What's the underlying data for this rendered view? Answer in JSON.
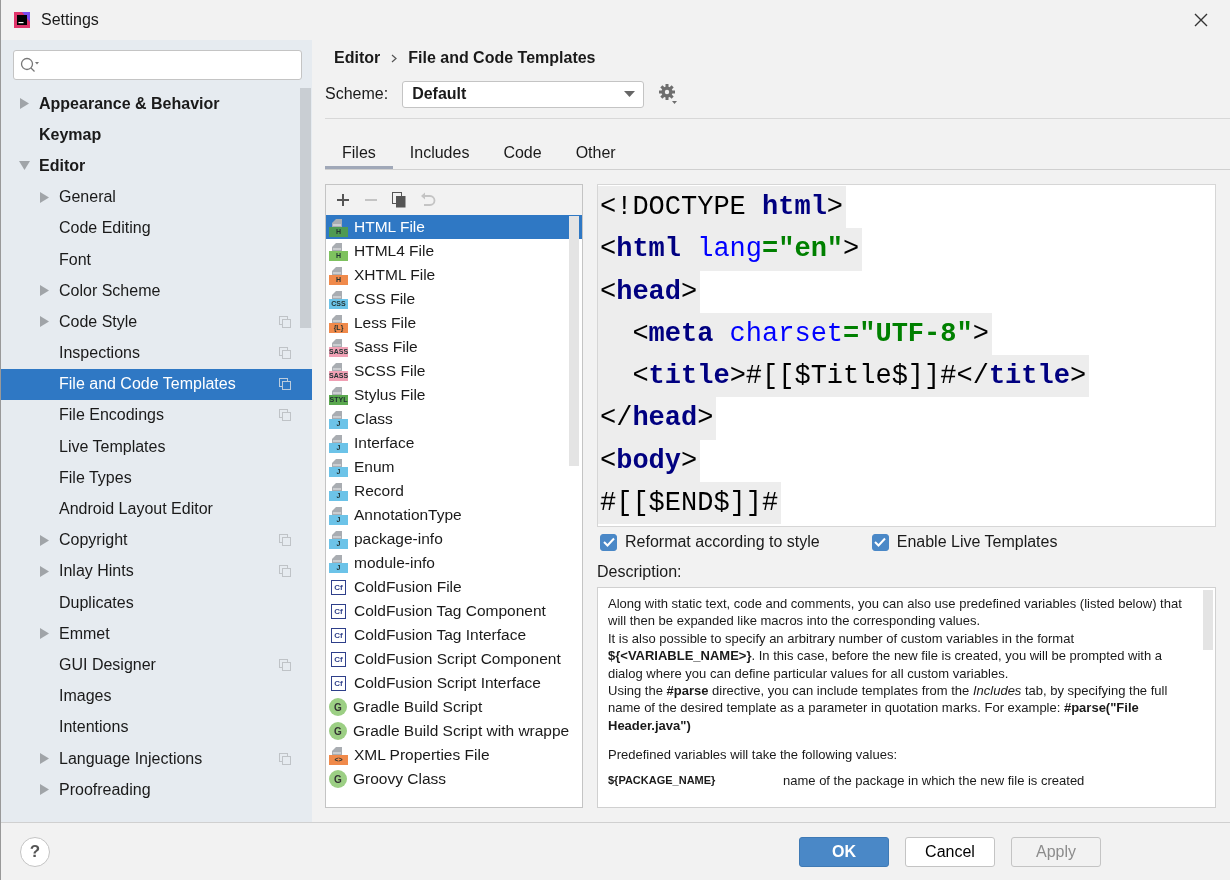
{
  "window": {
    "title": "Settings"
  },
  "sidebar": {
    "items": [
      {
        "label": "Appearance & Behavior",
        "expandable": true,
        "expanded": false,
        "selected": false,
        "project_level": false
      },
      {
        "label": "Keymap",
        "expandable": false,
        "selected": false,
        "project_level": false
      },
      {
        "label": "Editor",
        "expandable": true,
        "expanded": true,
        "selected": false,
        "project_level": false,
        "children": [
          {
            "label": "General",
            "expandable": true,
            "expanded": false,
            "selected": false,
            "project_level": false
          },
          {
            "label": "Code Editing",
            "expandable": false,
            "selected": false,
            "project_level": false
          },
          {
            "label": "Font",
            "expandable": false,
            "selected": false,
            "project_level": false
          },
          {
            "label": "Color Scheme",
            "expandable": true,
            "expanded": false,
            "selected": false,
            "project_level": false
          },
          {
            "label": "Code Style",
            "expandable": true,
            "expanded": false,
            "selected": false,
            "project_level": true
          },
          {
            "label": "Inspections",
            "expandable": false,
            "selected": false,
            "project_level": true
          },
          {
            "label": "File and Code Templates",
            "expandable": false,
            "selected": true,
            "project_level": true
          },
          {
            "label": "File Encodings",
            "expandable": false,
            "selected": false,
            "project_level": true
          },
          {
            "label": "Live Templates",
            "expandable": false,
            "selected": false,
            "project_level": false
          },
          {
            "label": "File Types",
            "expandable": false,
            "selected": false,
            "project_level": false
          },
          {
            "label": "Android Layout Editor",
            "expandable": false,
            "selected": false,
            "project_level": false
          },
          {
            "label": "Copyright",
            "expandable": true,
            "expanded": false,
            "selected": false,
            "project_level": true
          },
          {
            "label": "Inlay Hints",
            "expandable": true,
            "expanded": false,
            "selected": false,
            "project_level": true
          },
          {
            "label": "Duplicates",
            "expandable": false,
            "selected": false,
            "project_level": false
          },
          {
            "label": "Emmet",
            "expandable": true,
            "expanded": false,
            "selected": false,
            "project_level": false
          },
          {
            "label": "GUI Designer",
            "expandable": false,
            "selected": false,
            "project_level": true
          },
          {
            "label": "Images",
            "expandable": false,
            "selected": false,
            "project_level": false
          },
          {
            "label": "Intentions",
            "expandable": false,
            "selected": false,
            "project_level": false
          },
          {
            "label": "Language Injections",
            "expandable": true,
            "expanded": false,
            "selected": false,
            "project_level": true
          },
          {
            "label": "Proofreading",
            "expandable": true,
            "expanded": false,
            "selected": false,
            "project_level": false
          }
        ]
      }
    ]
  },
  "breadcrumb": [
    "Editor",
    "File and Code Templates"
  ],
  "scheme": {
    "label": "Scheme:",
    "value": "Default"
  },
  "tabs": [
    {
      "label": "Files",
      "selected": true
    },
    {
      "label": "Includes",
      "selected": false
    },
    {
      "label": "Code",
      "selected": false
    },
    {
      "label": "Other",
      "selected": false
    }
  ],
  "toolbar": [
    {
      "kind": "add",
      "disabled": false
    },
    {
      "kind": "remove",
      "disabled": true
    },
    {
      "kind": "copy",
      "disabled": false
    },
    {
      "kind": "reset",
      "disabled": true
    }
  ],
  "templates": [
    {
      "label": "HTML File",
      "kind": "file",
      "badge": "H",
      "color": "#4e9a52",
      "selected": true
    },
    {
      "label": "HTML4 File",
      "kind": "file",
      "badge": "H",
      "color": "#7ec25f",
      "selected": false
    },
    {
      "label": "XHTML File",
      "kind": "file",
      "badge": "H",
      "color": "#f08a4b",
      "selected": false
    },
    {
      "label": "CSS File",
      "kind": "file",
      "badge": "CSS",
      "color": "#6cc3e8",
      "selected": false
    },
    {
      "label": "Less File",
      "kind": "file",
      "badge": "{L}",
      "color": "#f08a4b",
      "selected": false
    },
    {
      "label": "Sass File",
      "kind": "file",
      "badge": "SASS",
      "color": "#f0a0b4",
      "selected": false
    },
    {
      "label": "SCSS File",
      "kind": "file",
      "badge": "SASS",
      "color": "#f0a0b4",
      "selected": false
    },
    {
      "label": "Stylus File",
      "kind": "file",
      "badge": "STYL",
      "color": "#5aa84e",
      "selected": false
    },
    {
      "label": "Class",
      "kind": "file",
      "badge": "J",
      "color": "#6cc3e8",
      "selected": false
    },
    {
      "label": "Interface",
      "kind": "file",
      "badge": "J",
      "color": "#6cc3e8",
      "selected": false
    },
    {
      "label": "Enum",
      "kind": "file",
      "badge": "J",
      "color": "#6cc3e8",
      "selected": false
    },
    {
      "label": "Record",
      "kind": "file",
      "badge": "J",
      "color": "#6cc3e8",
      "selected": false
    },
    {
      "label": "AnnotationType",
      "kind": "file",
      "badge": "J",
      "color": "#6cc3e8",
      "selected": false
    },
    {
      "label": "package-info",
      "kind": "file",
      "badge": "J",
      "color": "#6cc3e8",
      "selected": false
    },
    {
      "label": "module-info",
      "kind": "file",
      "badge": "J",
      "color": "#6cc3e8",
      "selected": false
    },
    {
      "label": "ColdFusion File",
      "kind": "square",
      "badge": "Cf",
      "color": "#2e3f8a",
      "selected": false
    },
    {
      "label": "ColdFusion Tag Component",
      "kind": "square",
      "badge": "Cf",
      "color": "#2e3f8a",
      "selected": false
    },
    {
      "label": "ColdFusion Tag Interface",
      "kind": "square",
      "badge": "Cf",
      "color": "#2e3f8a",
      "selected": false
    },
    {
      "label": "ColdFusion Script Component",
      "kind": "square",
      "badge": "Cf",
      "color": "#2e3f8a",
      "selected": false
    },
    {
      "label": "ColdFusion Script Interface",
      "kind": "square",
      "badge": "Cf",
      "color": "#2e3f8a",
      "selected": false
    },
    {
      "label": "Gradle Build Script",
      "kind": "circle",
      "badge": "G",
      "color": "#9ccf84",
      "selected": false
    },
    {
      "label": "Gradle Build Script with wrappe",
      "kind": "circle",
      "badge": "G",
      "color": "#9ccf84",
      "selected": false
    },
    {
      "label": "XML Properties File",
      "kind": "file",
      "badge": "<>",
      "color": "#f08a4b",
      "selected": false
    },
    {
      "label": "Groovy Class",
      "kind": "circle",
      "badge": "G",
      "color": "#9ccf84",
      "selected": false
    }
  ],
  "code": [
    [
      {
        "text": "<!DOCTYPE ",
        "kind": "plain"
      },
      {
        "text": "html",
        "kind": "tag"
      },
      {
        "text": ">",
        "kind": "plain"
      }
    ],
    [
      {
        "text": "<",
        "kind": "plain"
      },
      {
        "text": "html",
        "kind": "tag"
      },
      {
        "text": " lang",
        "kind": "attr"
      },
      {
        "text": "=\"en\"",
        "kind": "value"
      },
      {
        "text": ">",
        "kind": "plain"
      }
    ],
    [
      {
        "text": "<",
        "kind": "plain"
      },
      {
        "text": "head",
        "kind": "tag"
      },
      {
        "text": ">",
        "kind": "plain"
      }
    ],
    [
      {
        "text": "  <",
        "kind": "plain"
      },
      {
        "text": "meta",
        "kind": "tag"
      },
      {
        "text": " charset",
        "kind": "attr"
      },
      {
        "text": "=\"UTF-8\"",
        "kind": "value"
      },
      {
        "text": ">",
        "kind": "plain"
      }
    ],
    [
      {
        "text": "  <",
        "kind": "plain"
      },
      {
        "text": "title",
        "kind": "tag"
      },
      {
        "text": ">#[[$Title$]]#</",
        "kind": "plain"
      },
      {
        "text": "title",
        "kind": "tag"
      },
      {
        "text": ">",
        "kind": "plain"
      }
    ],
    [
      {
        "text": "</",
        "kind": "plain"
      },
      {
        "text": "head",
        "kind": "tag"
      },
      {
        "text": ">",
        "kind": "plain"
      }
    ],
    [
      {
        "text": "<",
        "kind": "plain"
      },
      {
        "text": "body",
        "kind": "tag"
      },
      {
        "text": ">",
        "kind": "plain"
      }
    ],
    [
      {
        "text": "#[[$END$]]#",
        "kind": "plain"
      }
    ]
  ],
  "options": [
    {
      "label": "Reformat according to style",
      "checked": true
    },
    {
      "label": "Enable Live Templates",
      "checked": true
    }
  ],
  "description": {
    "title": "Description:",
    "paragraphs": [
      "Along with static text, code and comments, you can also use predefined variables (listed below) that will then be expanded like macros into the corresponding values.",
      "It is also possible to specify an arbitrary number of custom variables in the format **${<VARIABLE_NAME>}**. In this case, before the new file is created, you will be prompted with a dialog where you can define particular values for all custom variables.",
      "Using the **#parse** directive, you can include templates from the *Includes* tab, by specifying the full name of the desired template as a parameter in quotation marks. For example: **#parse(\"File Header.java\")**"
    ],
    "variables_intro": "Predefined variables will take the following values:",
    "variables": [
      {
        "name": "${PACKAGE_NAME}",
        "meaning": "name of the package in which the new file is created"
      }
    ]
  },
  "buttons": [
    {
      "label": "OK",
      "kind": "primary",
      "disabled": false
    },
    {
      "label": "Cancel",
      "kind": "normal",
      "disabled": false
    },
    {
      "label": "Apply",
      "kind": "normal",
      "disabled": true
    }
  ],
  "help": {
    "label": "?"
  }
}
